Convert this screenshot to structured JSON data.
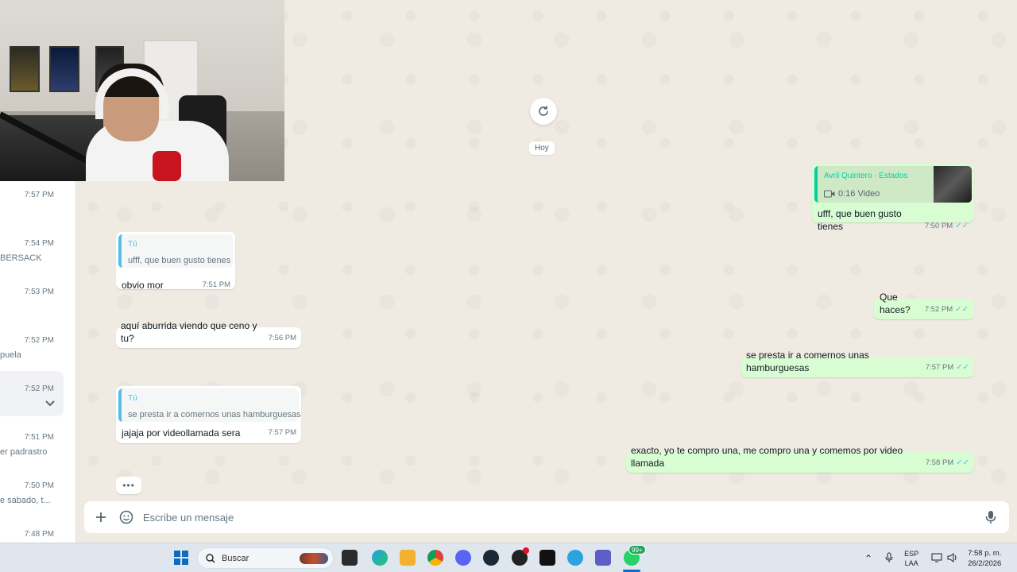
{
  "chat_list": {
    "items": [
      {
        "time": "7:57 PM",
        "snippet": ""
      },
      {
        "time": "7:54 PM",
        "snippet": "BERSACK"
      },
      {
        "time": "7:53 PM",
        "snippet": ""
      },
      {
        "time": "7:52 PM",
        "snippet": "puela"
      },
      {
        "time": "7:52 PM",
        "snippet": ""
      },
      {
        "time": "7:51 PM",
        "snippet": "er padrastro"
      },
      {
        "time": "7:50 PM",
        "snippet": "e sabado, t..."
      },
      {
        "time": "7:48 PM",
        "snippet": ""
      }
    ]
  },
  "conversation": {
    "day_label": "Hoy",
    "messages": [
      {
        "direction": "out",
        "quote_author": "Avril Quintero · Estados",
        "quote_media": "0:16 Video",
        "text": "ufff, que buen gusto tienes",
        "time": "7:50 PM"
      },
      {
        "direction": "in",
        "quote_author": "Tú",
        "quote_text": "ufff, que buen gusto tienes",
        "text": "obvio mor",
        "time": "7:51 PM"
      },
      {
        "direction": "out",
        "text": "Que haces?",
        "time": "7:52 PM"
      },
      {
        "direction": "in",
        "text": "aquí aburrida viendo que ceno y tu?",
        "time": "7:56 PM"
      },
      {
        "direction": "out",
        "text": "se presta ir a comernos unas hamburguesas",
        "time": "7:57 PM"
      },
      {
        "direction": "in",
        "quote_author": "Tú",
        "quote_text": "se presta ir a comernos unas hamburguesas",
        "text": "jajaja por videollamada sera",
        "time": "7:57 PM"
      },
      {
        "direction": "out",
        "text": "exacto, yo te compro una, me compro una y comemos por video llamada",
        "time": "7:58 PM"
      }
    ],
    "typing_indicator": "•••"
  },
  "composer": {
    "placeholder": "Escribe un mensaje"
  },
  "taskbar": {
    "search_label": "Buscar",
    "badge": "99+",
    "lang_line1": "ESP",
    "lang_line2": "LAA",
    "clock_time": "7:58 p. m.",
    "clock_date": "26/2/2026"
  },
  "colors": {
    "outgoing_bubble": "#d9fdd3",
    "incoming_bubble": "#ffffff",
    "read_ticks": "#53bdeb",
    "wallpaper": "#efeae2",
    "quote_author_green": "#06cf9c"
  }
}
